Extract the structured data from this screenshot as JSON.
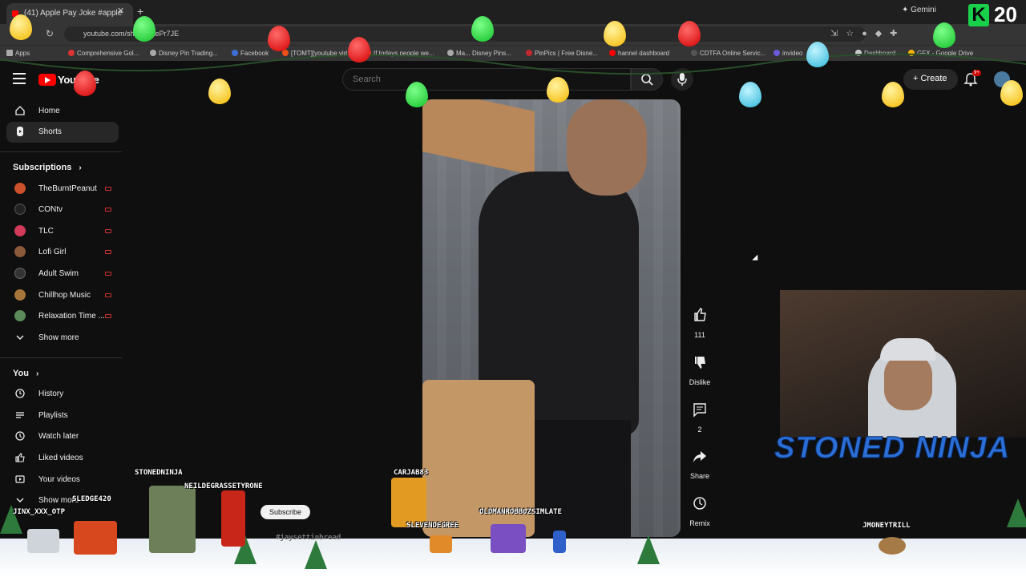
{
  "browser": {
    "tab_title": "(41) Apple Pay Joke #apple",
    "close_glyph": "✕",
    "new_tab_glyph": "+",
    "url": "youtube.com/sh...5dXtePr7JE",
    "gemini_label": "✦ Gemini",
    "back_glyph": "←",
    "reload_glyph": "↻",
    "bookmarks": [
      {
        "label": "Apps"
      },
      {
        "label": "Comprehensive Gol..."
      },
      {
        "label": "Disney Pin Trading..."
      },
      {
        "label": "Facebook"
      },
      {
        "label": "[TOMT][youtube vid..."
      },
      {
        "label": "If todays people we..."
      },
      {
        "label": "Ma... Disney Pins..."
      },
      {
        "label": "PinPics | Free Disne..."
      },
      {
        "label": "hannel dashboard"
      },
      {
        "label": "CDTFA Online Servic..."
      },
      {
        "label": "invideo"
      },
      {
        "label": "Dashboard"
      },
      {
        "label": "GFX - Google Drive"
      }
    ]
  },
  "header": {
    "logo_text": "YouTube",
    "search_placeholder": "Search",
    "create_label": "Create",
    "notif_badge": "9+"
  },
  "sidebar": {
    "top": [
      {
        "label": "Home",
        "icon": "home-icon"
      },
      {
        "label": "Shorts",
        "icon": "shorts-icon"
      }
    ],
    "subscriptions_heading": "Subscriptions",
    "subscriptions": [
      {
        "label": "TheBurntPeanut",
        "color": "#c9502a"
      },
      {
        "label": "CONtv",
        "color": "#222222"
      },
      {
        "label": "TLC",
        "color": "#d33a5a"
      },
      {
        "label": "Lofi Girl",
        "color": "#8a5a3a"
      },
      {
        "label": "Adult Swim",
        "color": "#333333"
      },
      {
        "label": "Chillhop Music",
        "color": "#a8763a"
      },
      {
        "label": "Relaxation Time ...",
        "color": "#5a8a5a"
      }
    ],
    "show_more": "Show more",
    "you_heading": "You",
    "you_items": [
      {
        "label": "History",
        "icon": "history-icon"
      },
      {
        "label": "Playlists",
        "icon": "playlists-icon"
      },
      {
        "label": "Watch later",
        "icon": "watch-later-icon"
      },
      {
        "label": "Liked videos",
        "icon": "liked-videos-icon"
      },
      {
        "label": "Your videos",
        "icon": "your-videos-icon"
      },
      {
        "label": "Show more",
        "icon": "chevron-down-icon"
      }
    ]
  },
  "shorts": {
    "likes": "111",
    "dislike_label": "Dislike",
    "comments": "2",
    "share_label": "Share",
    "remix_label": "Remix",
    "subscribe_label": "Subscribe"
  },
  "overlay": {
    "counter": "20",
    "counter_letter": "K",
    "webcam_title": "STONED NINJA",
    "viewer_names": [
      "STONEDNINJA",
      "NEILDEGRASSETYRONE",
      "SLEDGE420",
      "JINX_XXX_OTP",
      "CARJAB83",
      "OLDMANROBB0ZSIMLATE",
      "SLEVENDEGREE",
      "JMONEYTRILL"
    ],
    "misc_text": "#jaysettinbread"
  }
}
